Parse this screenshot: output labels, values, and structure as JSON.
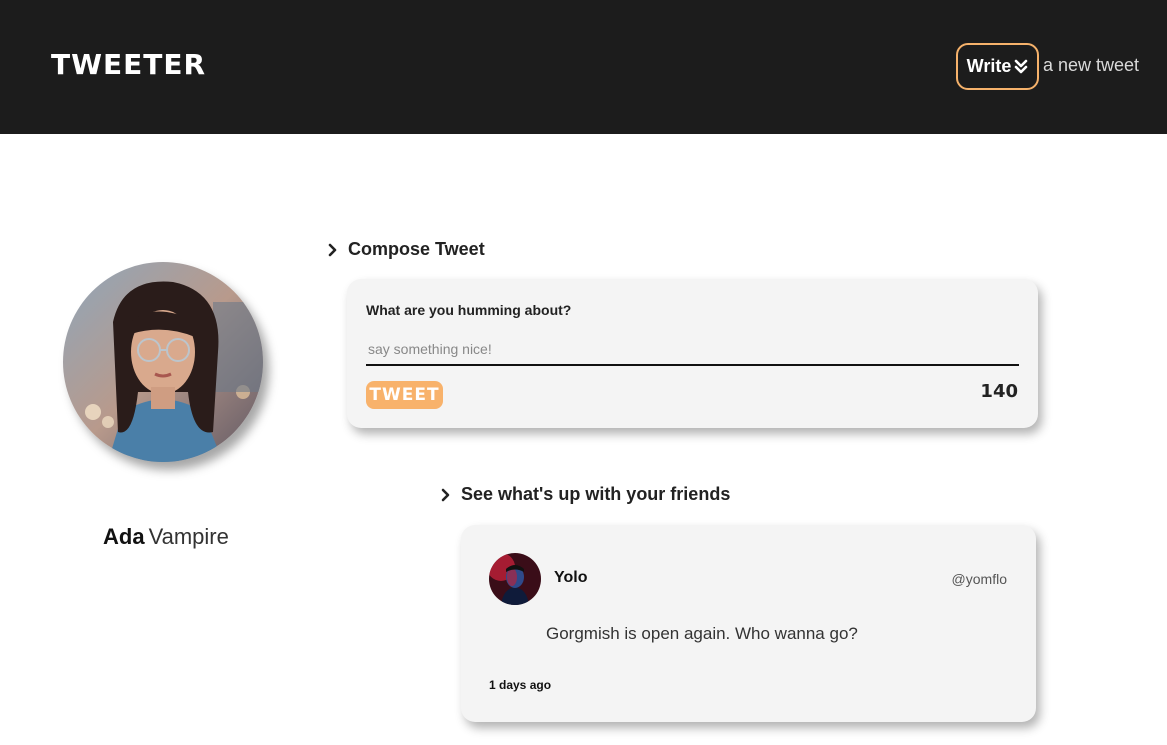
{
  "nav": {
    "brand": "TWEETER",
    "write_label": "Write",
    "write_rest": "a new tweet",
    "write_icon": "double-chevron-down-icon"
  },
  "colors": {
    "nav_bg": "#1c1c1c",
    "accent": "#f8b26b",
    "card_bg": "#f4f4f4"
  },
  "profile": {
    "first_name": "Ada",
    "last_name": "Vampire"
  },
  "compose": {
    "heading": "Compose Tweet",
    "label": "What are you humming about?",
    "placeholder": "say something nice!",
    "button_label": "TWEET",
    "counter": "140"
  },
  "feed": {
    "heading": "See what's up with your friends",
    "tweets": [
      {
        "name": "Yolo",
        "handle": "@yomflo",
        "content": "Gorgmish is open again. Who wanna go?",
        "time": "1 days ago"
      }
    ]
  }
}
